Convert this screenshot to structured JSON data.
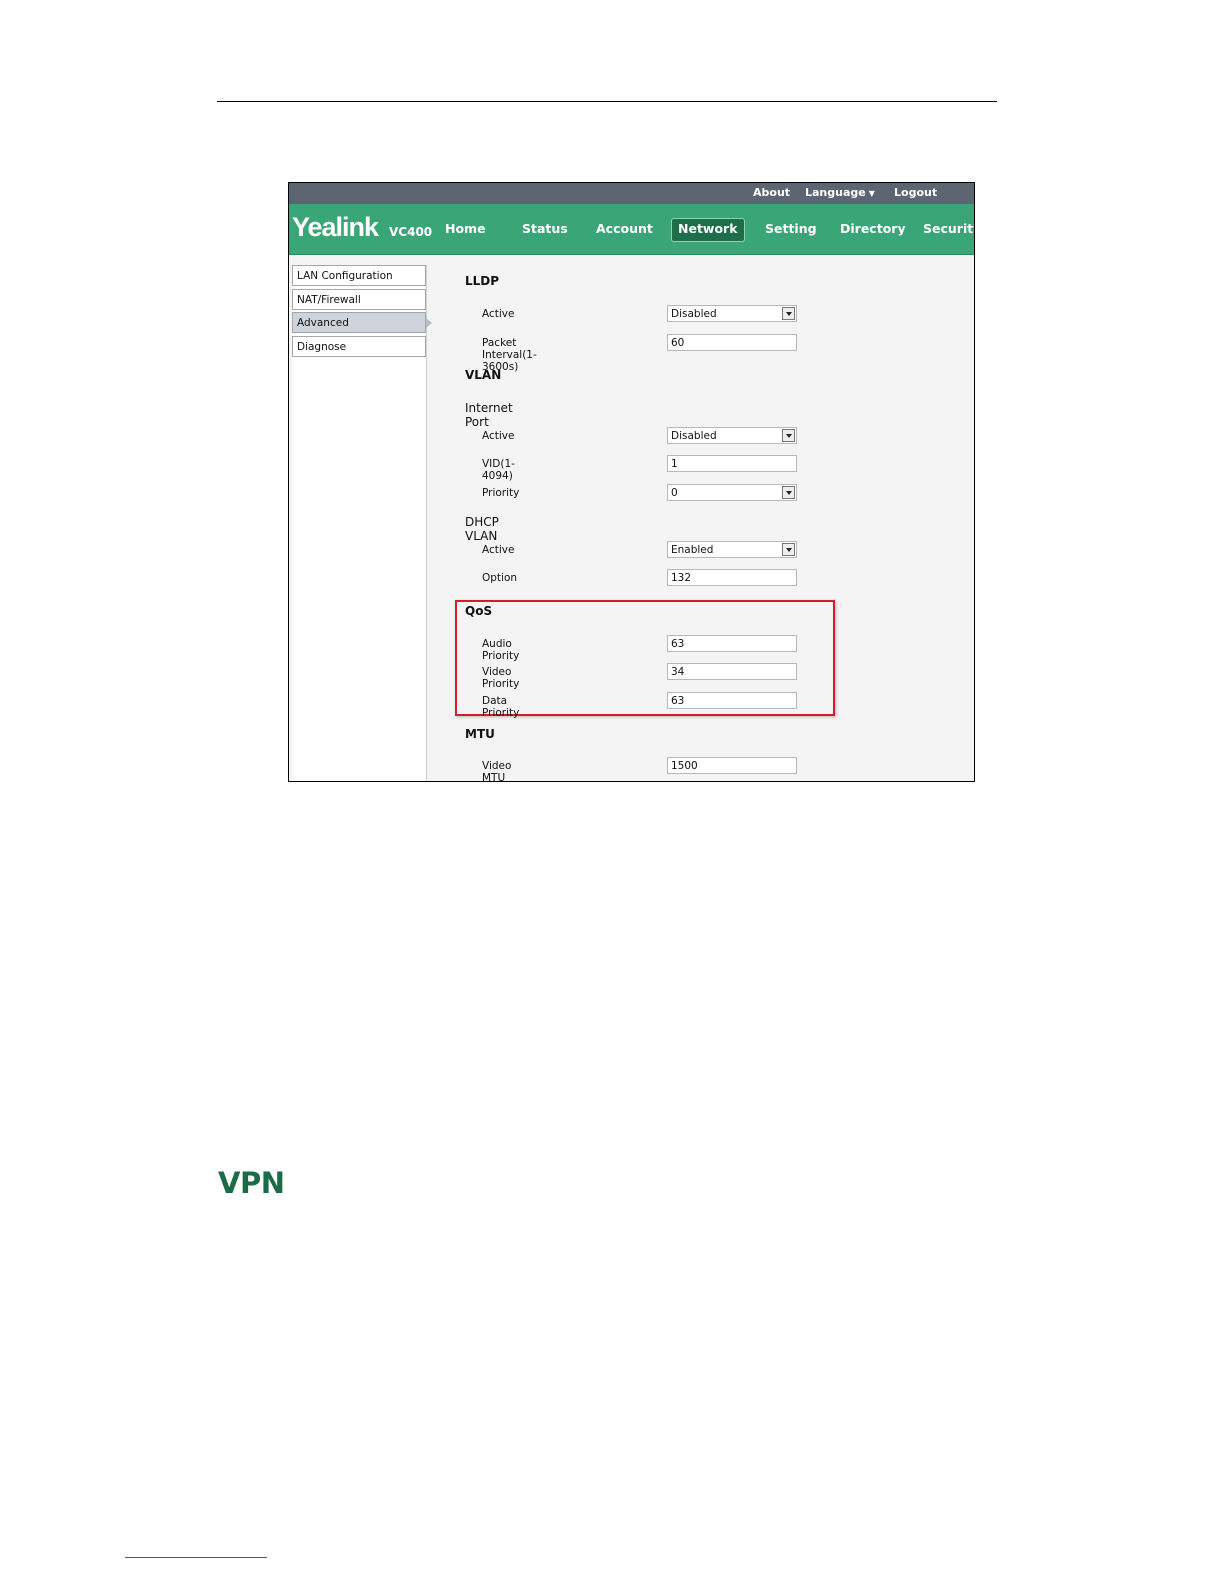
{
  "topbar": {
    "about": "About",
    "language": "Language",
    "logout": "Logout"
  },
  "brand": {
    "logo": "Yealink",
    "model": "VC400"
  },
  "nav": {
    "home": "Home",
    "status": "Status",
    "account": "Account",
    "network": "Network",
    "setting": "Setting",
    "directory": "Directory",
    "security": "Security"
  },
  "sidebar": {
    "lan": "LAN Configuration",
    "nat": "NAT/Firewall",
    "advanced": "Advanced",
    "diagnose": "Diagnose"
  },
  "lldp": {
    "title": "LLDP",
    "active_label": "Active",
    "active_value": "Disabled",
    "interval_label": "Packet Interval(1-3600s)",
    "interval_value": "60"
  },
  "vlan": {
    "title": "VLAN",
    "internet_port": "Internet Port",
    "active_label": "Active",
    "active_value": "Disabled",
    "vid_label": "VID(1-4094)",
    "vid_value": "1",
    "priority_label": "Priority",
    "priority_value": "0",
    "dhcp_vlan": "DHCP VLAN",
    "dhcp_active_label": "Active",
    "dhcp_active_value": "Enabled",
    "option_label": "Option",
    "option_value": "132"
  },
  "qos": {
    "title": "QoS",
    "audio_label": "Audio Priority",
    "audio_value": "63",
    "video_label": "Video Priority",
    "video_value": "34",
    "data_label": "Data Priority",
    "data_value": "63"
  },
  "mtu": {
    "title": "MTU",
    "video_label": "Video MTU",
    "video_value": "1500"
  },
  "document": {
    "vpn_heading": "VPN"
  },
  "colors": {
    "nav_green": "#3aa678",
    "highlight_red": "#d21e2b",
    "heading_green": "#1c6b48"
  }
}
